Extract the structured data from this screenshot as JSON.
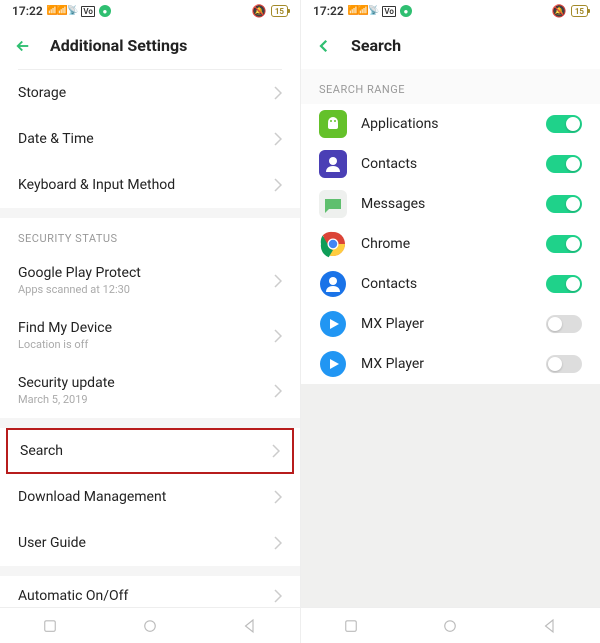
{
  "status": {
    "time": "17:22",
    "battery": "15"
  },
  "left": {
    "title": "Additional Settings",
    "rows1": [
      {
        "label": "Storage"
      },
      {
        "label": "Date & Time"
      },
      {
        "label": "Keyboard & Input Method"
      }
    ],
    "security_header": "SECURITY STATUS",
    "rows2": [
      {
        "label": "Google Play Protect",
        "sub": "Apps scanned at 12:30"
      },
      {
        "label": "Find My Device",
        "sub": "Location is off"
      },
      {
        "label": "Security update",
        "sub": "March 5, 2019"
      }
    ],
    "rows3": [
      {
        "label": "Search",
        "highlight": true
      },
      {
        "label": "Download Management"
      },
      {
        "label": "User Guide"
      }
    ],
    "cutoff": "Automatic On/Off"
  },
  "right": {
    "title": "Search",
    "section_header": "SEARCH RANGE",
    "items": [
      {
        "label": "Applications",
        "icon": "android",
        "on": true
      },
      {
        "label": "Contacts",
        "icon": "contacts-purple",
        "on": true
      },
      {
        "label": "Messages",
        "icon": "messages",
        "on": true
      },
      {
        "label": "Chrome",
        "icon": "chrome",
        "on": true
      },
      {
        "label": "Contacts",
        "icon": "contacts-blue",
        "on": true
      },
      {
        "label": "MX Player",
        "icon": "mx",
        "on": false
      },
      {
        "label": "MX Player",
        "icon": "mx",
        "on": false
      }
    ]
  }
}
